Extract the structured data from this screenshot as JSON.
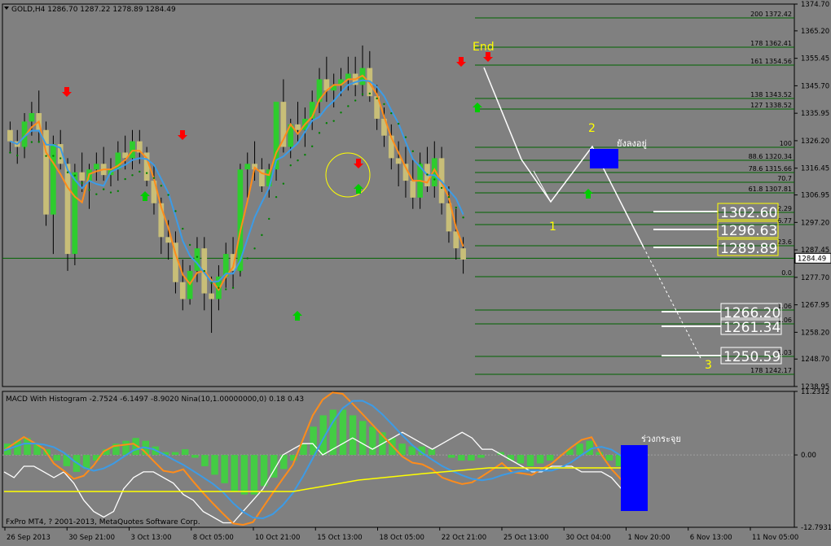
{
  "header": {
    "symbol": "GOLD,H4",
    "ohlc": "1286.70 1287.22 1278.89 1284.49"
  },
  "macd_header": "MACD With Histogram -2.7524 -6.1497 -8.9020  Nina(10,1.00000000,0) 0.18 0.43",
  "footer_text": "FxPro MT4, ? 2001-2013, MetaQuotes Software Corp.",
  "annotations": {
    "end": "End",
    "wave_1": "1",
    "wave_2": "2",
    "wave_3": "3",
    "thai_still_down": "ยังลงอยู่",
    "thai_macd_range": "ร่วงกระจุย"
  },
  "colors": {
    "background": "#808080",
    "bull_candle": "#2ECC2E",
    "bear_candle": "#C8BE78",
    "ma_fast": "#FF8C1A",
    "ma_slow": "#3C9BE6",
    "ma_mid": "#008000",
    "fibo_line": "#006400",
    "target_box": "#FFFF00",
    "sell_arrow": "#FF0000",
    "buy_arrow": "#00CC00",
    "macd_zone": "#0000FF"
  },
  "chart_data": [
    {
      "type": "candlestick",
      "title": "GOLD,H4",
      "ylim": [
        1238.95,
        1374.7
      ],
      "y_ticks": [
        "1374.70",
        "1365.20",
        "1355.45",
        "1345.70",
        "1335.95",
        "1326.20",
        "1316.45",
        "1306.95",
        "1297.20",
        "1287.45",
        "1277.70",
        "1267.95",
        "1258.20",
        "1248.70",
        "1238.95"
      ],
      "last_price": "1284.49",
      "x_ticks": [
        "26 Sep 2013",
        "30 Sep 21:00",
        "3 Oct 13:00",
        "8 Oct 05:00",
        "10 Oct 21:00",
        "15 Oct 13:00",
        "18 Oct 05:00",
        "22 Oct 21:00",
        "25 Oct 13:00",
        "30 Oct 04:00",
        "1 Nov 20:00",
        "6 Nov 13:00",
        "11 Nov 05:00"
      ],
      "fibo_levels": [
        {
          "label": "200",
          "price": "1372.42"
        },
        {
          "label": "178",
          "price": "1362.41"
        },
        {
          "label": "161",
          "price": "1354.56"
        },
        {
          "label": "138",
          "price": "1343.52"
        },
        {
          "label": "127",
          "price": "1338.52"
        },
        {
          "label": "100",
          "price": ""
        },
        {
          "label": "88.6",
          "price": "1320.34"
        },
        {
          "label": "78.6",
          "price": "1315.66"
        },
        {
          "label": "70.7",
          "price": ""
        },
        {
          "label": "61.8",
          "price": "1307.81"
        },
        {
          "label": "",
          "price": "2.29"
        },
        {
          "label": "",
          "price": "6.77"
        },
        {
          "label": "23.6",
          "price": ""
        },
        {
          "label": "0.0",
          "price": ""
        },
        {
          "label": "",
          "price": "1.06"
        },
        {
          "label": "",
          "price": "1.06"
        },
        {
          "label": "",
          "price": "1.03"
        },
        {
          "label": "178",
          "price": "1242.17"
        }
      ],
      "targets": [
        "1302.60",
        "1296.63",
        "1289.89",
        "1266.20",
        "1261.34",
        "1250.59"
      ],
      "candles": [
        [
          1330,
          1333,
          1322,
          1326
        ],
        [
          1326,
          1330,
          1318,
          1324
        ],
        [
          1324,
          1336,
          1320,
          1333
        ],
        [
          1333,
          1340,
          1328,
          1336
        ],
        [
          1336,
          1344,
          1326,
          1330
        ],
        [
          1330,
          1333,
          1296,
          1300
        ],
        [
          1300,
          1328,
          1286,
          1325
        ],
        [
          1325,
          1330,
          1316,
          1318
        ],
        [
          1318,
          1320,
          1280,
          1286
        ],
        [
          1286,
          1318,
          1282,
          1315
        ],
        [
          1315,
          1322,
          1308,
          1312
        ],
        [
          1312,
          1318,
          1302,
          1316
        ],
        [
          1316,
          1322,
          1312,
          1318
        ],
        [
          1318,
          1324,
          1312,
          1314
        ],
        [
          1314,
          1320,
          1310,
          1316
        ],
        [
          1316,
          1326,
          1312,
          1322
        ],
        [
          1322,
          1328,
          1316,
          1320
        ],
        [
          1320,
          1330,
          1316,
          1326
        ],
        [
          1326,
          1330,
          1318,
          1322
        ],
        [
          1322,
          1324,
          1310,
          1312
        ],
        [
          1312,
          1318,
          1300,
          1304
        ],
        [
          1304,
          1306,
          1286,
          1292
        ],
        [
          1292,
          1298,
          1284,
          1290
        ],
        [
          1290,
          1294,
          1272,
          1276
        ],
        [
          1276,
          1284,
          1266,
          1270
        ],
        [
          1270,
          1282,
          1268,
          1280
        ],
        [
          1280,
          1292,
          1276,
          1288
        ],
        [
          1288,
          1292,
          1266,
          1272
        ],
        [
          1272,
          1278,
          1258,
          1270
        ],
        [
          1270,
          1282,
          1266,
          1278
        ],
        [
          1278,
          1290,
          1274,
          1286
        ],
        [
          1286,
          1292,
          1274,
          1280
        ],
        [
          1280,
          1318,
          1278,
          1316
        ],
        [
          1316,
          1322,
          1306,
          1318
        ],
        [
          1318,
          1326,
          1312,
          1316
        ],
        [
          1316,
          1320,
          1308,
          1310
        ],
        [
          1310,
          1318,
          1306,
          1316
        ],
        [
          1316,
          1336,
          1312,
          1340
        ],
        [
          1340,
          1348,
          1322,
          1324
        ],
        [
          1324,
          1334,
          1320,
          1332
        ],
        [
          1332,
          1340,
          1326,
          1330
        ],
        [
          1330,
          1338,
          1324,
          1334
        ],
        [
          1334,
          1344,
          1330,
          1340
        ],
        [
          1340,
          1352,
          1336,
          1348
        ],
        [
          1348,
          1356,
          1340,
          1344
        ],
        [
          1344,
          1350,
          1338,
          1346
        ],
        [
          1346,
          1352,
          1342,
          1348
        ],
        [
          1348,
          1356,
          1344,
          1350
        ],
        [
          1350,
          1356,
          1342,
          1346
        ],
        [
          1346,
          1360,
          1342,
          1352
        ],
        [
          1352,
          1358,
          1340,
          1342
        ],
        [
          1342,
          1346,
          1330,
          1334
        ],
        [
          1334,
          1338,
          1324,
          1328
        ],
        [
          1328,
          1332,
          1316,
          1320
        ],
        [
          1320,
          1326,
          1310,
          1318
        ],
        [
          1318,
          1324,
          1306,
          1312
        ],
        [
          1312,
          1320,
          1302,
          1306
        ],
        [
          1306,
          1322,
          1302,
          1318
        ],
        [
          1318,
          1324,
          1308,
          1310
        ],
        [
          1310,
          1326,
          1306,
          1320
        ],
        [
          1320,
          1324,
          1300,
          1304
        ],
        [
          1304,
          1310,
          1290,
          1294
        ],
        [
          1294,
          1302,
          1284,
          1288
        ],
        [
          1288,
          1292,
          1279,
          1284
        ]
      ]
    },
    {
      "type": "line",
      "title": "MACD With Histogram",
      "ylim": [
        -12.7931,
        11.2312
      ],
      "y_ticks": [
        "11.2312",
        "0.00",
        "-12.7931"
      ],
      "zero_line": 0,
      "histogram": [
        2,
        2.5,
        3,
        2,
        1,
        -1,
        -2,
        -3,
        -2.5,
        -1,
        1,
        2,
        2.5,
        3,
        2.5,
        1.5,
        0.5,
        0.5,
        1,
        -0.5,
        -2,
        -3.5,
        -5,
        -6.5,
        -7,
        -7,
        -5.5,
        -4,
        -2.5,
        -1,
        2,
        5,
        7,
        8,
        8,
        7,
        6,
        5,
        4,
        3,
        2,
        1.5,
        1.5,
        1,
        0,
        -0.5,
        -1,
        -1,
        -0.5,
        0,
        0.5,
        -1,
        -1.5,
        -2,
        -1.5,
        -1,
        0,
        1,
        2,
        2.5,
        0.5,
        -1,
        -2,
        -3
      ],
      "series": [
        {
          "name": "Nina",
          "values": [
            -3,
            -4,
            -2,
            -2,
            -3,
            -4,
            -3,
            -5,
            -8,
            -10,
            -11,
            -10,
            -6,
            -4,
            -3,
            -3,
            -4,
            -5,
            -7,
            -8,
            -10,
            -11,
            -12,
            -12,
            -10,
            -8,
            -6,
            -3,
            0,
            1,
            2,
            2,
            0,
            1,
            2,
            3,
            2,
            1,
            2,
            3,
            4,
            3,
            2,
            1,
            2,
            3,
            4,
            3,
            1,
            1,
            0,
            -1,
            -2,
            -3,
            -3,
            -2,
            -2,
            -2,
            -3,
            -3,
            -3,
            -4,
            -6,
            -9
          ]
        }
      ]
    }
  ]
}
